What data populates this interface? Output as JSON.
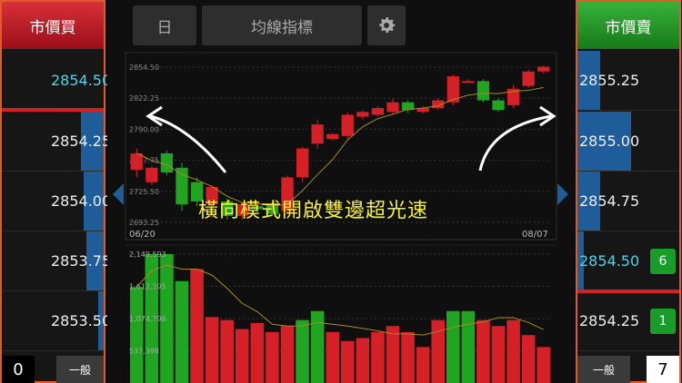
{
  "left": {
    "header": "市價買",
    "rows": [
      {
        "price": "2854.50",
        "bar": 0,
        "color": "#4fd3e6"
      },
      {
        "price": "2854.25",
        "bar": 0.22,
        "color": "#eeeeee"
      },
      {
        "price": "2854.00",
        "bar": 0.2,
        "color": "#eeeeee"
      },
      {
        "price": "2853.75",
        "bar": 0.17,
        "color": "#eeeeee"
      },
      {
        "price": "2853.50",
        "bar": 0.05,
        "color": "#eeeeee"
      }
    ],
    "footer": {
      "count": "0",
      "label": "一般"
    }
  },
  "right": {
    "header": "市價賣",
    "rows": [
      {
        "price": "2855.25",
        "bar": 0.22,
        "qty": ""
      },
      {
        "price": "2855.00",
        "bar": 0.53,
        "qty": ""
      },
      {
        "price": "2854.75",
        "bar": 0.22,
        "qty": ""
      },
      {
        "price": "2854.50",
        "bar": 0.06,
        "qty": "6",
        "color": "#4fd3e6"
      },
      {
        "price": "2854.25",
        "bar": 0,
        "qty": "1"
      }
    ],
    "footer": {
      "count": "7",
      "label": "一般"
    }
  },
  "toolbar": {
    "period": "日",
    "indicator": "均線指標"
  },
  "chart": {
    "price_ticks": [
      "2854.50",
      "2822.25",
      "2790.00",
      "2757.75",
      "2725.50",
      "2693.25"
    ],
    "start_date": "06/20",
    "end_date": "08/07",
    "volume_ticks": [
      "2,149,593",
      "1,612,195",
      "1,074,796",
      "537,398"
    ]
  },
  "caption": "橫向模式開啟雙邊超光速",
  "colors": {
    "up": "#d42026",
    "down": "#1fa51f",
    "accent": "#e45a25"
  },
  "chart_data": {
    "type": "candlestick",
    "x_range": [
      "06/20",
      "08/07"
    ],
    "ylim": [
      2693.25,
      2854.5
    ],
    "candles": [
      {
        "o": 2748,
        "c": 2765,
        "h": 2770,
        "l": 2740
      },
      {
        "o": 2735,
        "c": 2750,
        "h": 2752,
        "l": 2732
      },
      {
        "o": 2765,
        "c": 2745,
        "h": 2768,
        "l": 2742
      },
      {
        "o": 2750,
        "c": 2712,
        "h": 2755,
        "l": 2705
      },
      {
        "o": 2735,
        "c": 2715,
        "h": 2740,
        "l": 2710
      },
      {
        "o": 2712,
        "c": 2730,
        "h": 2732,
        "l": 2698
      },
      {
        "o": 2715,
        "c": 2700,
        "h": 2718,
        "l": 2696
      },
      {
        "o": 2700,
        "c": 2712,
        "h": 2714,
        "l": 2696
      },
      {
        "o": 2710,
        "c": 2707,
        "h": 2712,
        "l": 2704
      },
      {
        "o": 2712,
        "c": 2702,
        "h": 2715,
        "l": 2700
      },
      {
        "o": 2705,
        "c": 2740,
        "h": 2742,
        "l": 2703
      },
      {
        "o": 2740,
        "c": 2770,
        "h": 2772,
        "l": 2735
      },
      {
        "o": 2775,
        "c": 2795,
        "h": 2800,
        "l": 2770
      },
      {
        "o": 2780,
        "c": 2785,
        "h": 2786,
        "l": 2778
      },
      {
        "o": 2783,
        "c": 2805,
        "h": 2807,
        "l": 2780
      },
      {
        "o": 2803,
        "c": 2808,
        "h": 2810,
        "l": 2800
      },
      {
        "o": 2805,
        "c": 2812,
        "h": 2814,
        "l": 2803
      },
      {
        "o": 2808,
        "c": 2818,
        "h": 2822,
        "l": 2806
      },
      {
        "o": 2818,
        "c": 2810,
        "h": 2820,
        "l": 2807
      },
      {
        "o": 2808,
        "c": 2812,
        "h": 2814,
        "l": 2806
      },
      {
        "o": 2812,
        "c": 2820,
        "h": 2822,
        "l": 2810
      },
      {
        "o": 2818,
        "c": 2845,
        "h": 2847,
        "l": 2815
      },
      {
        "o": 2840,
        "c": 2840,
        "h": 2842,
        "l": 2838
      },
      {
        "o": 2840,
        "c": 2820,
        "h": 2842,
        "l": 2818
      },
      {
        "o": 2820,
        "c": 2810,
        "h": 2822,
        "l": 2808
      },
      {
        "o": 2815,
        "c": 2832,
        "h": 2836,
        "l": 2812
      },
      {
        "o": 2835,
        "c": 2850,
        "h": 2852,
        "l": 2833
      },
      {
        "o": 2850,
        "c": 2855,
        "h": 2856,
        "l": 2848
      }
    ],
    "volume": [
      {
        "v": 1600000,
        "up": false
      },
      {
        "v": 2149593,
        "up": false
      },
      {
        "v": 2149593,
        "up": false
      },
      {
        "v": 1700000,
        "up": false
      },
      {
        "v": 1900000,
        "up": true
      },
      {
        "v": 1100000,
        "up": true
      },
      {
        "v": 1050000,
        "up": true
      },
      {
        "v": 900000,
        "up": true
      },
      {
        "v": 1000000,
        "up": true
      },
      {
        "v": 850000,
        "up": true
      },
      {
        "v": 950000,
        "up": true
      },
      {
        "v": 1050000,
        "up": false
      },
      {
        "v": 1200000,
        "up": false
      },
      {
        "v": 850000,
        "up": true
      },
      {
        "v": 700000,
        "up": true
      },
      {
        "v": 750000,
        "up": true
      },
      {
        "v": 850000,
        "up": true
      },
      {
        "v": 950000,
        "up": true
      },
      {
        "v": 850000,
        "up": true
      },
      {
        "v": 600000,
        "up": true
      },
      {
        "v": 1050000,
        "up": true
      },
      {
        "v": 1200000,
        "up": false
      },
      {
        "v": 1200000,
        "up": false
      },
      {
        "v": 1050000,
        "up": true
      },
      {
        "v": 950000,
        "up": true
      },
      {
        "v": 1050000,
        "up": true
      },
      {
        "v": 800000,
        "up": true
      },
      {
        "v": 600000,
        "up": true
      }
    ]
  }
}
